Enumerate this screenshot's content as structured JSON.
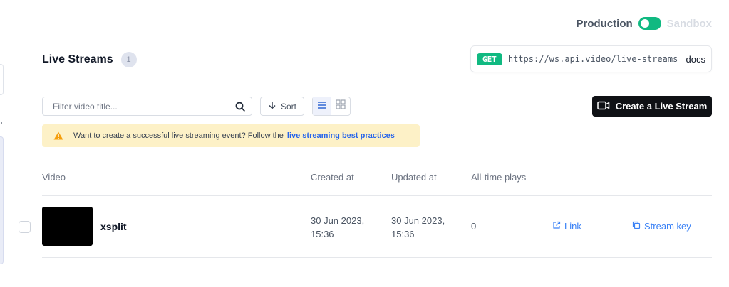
{
  "environment": {
    "production_label": "Production",
    "sandbox_label": "Sandbox",
    "active": "production"
  },
  "header": {
    "title": "Live Streams",
    "count": "1"
  },
  "api": {
    "method": "GET",
    "endpoint": "https://ws.api.video/live-streams",
    "docs_label": "docs"
  },
  "toolbar": {
    "search_placeholder": "Filter video title...",
    "search_value": "",
    "sort_label": "Sort",
    "view_mode": "list",
    "create_label": "Create a Live Stream"
  },
  "alert": {
    "text": "Want to create a successful live streaming event? Follow the",
    "link_label": "live streaming best practices"
  },
  "table": {
    "columns": [
      "Video",
      "Created at",
      "Updated at",
      "All-time plays"
    ],
    "rows": [
      {
        "name": "xsplit",
        "created_line1": "30 Jun 2023,",
        "created_line2": "15:36",
        "updated_line1": "30 Jun 2023,",
        "updated_line2": "15:36",
        "plays": "0",
        "link_label": "Link",
        "stream_key_label": "Stream key"
      }
    ]
  },
  "colors": {
    "accent_green": "#10b981",
    "link_blue": "#3b82f6",
    "primary_button": "#0f1115",
    "alert_bg": "#fdf1c7"
  }
}
